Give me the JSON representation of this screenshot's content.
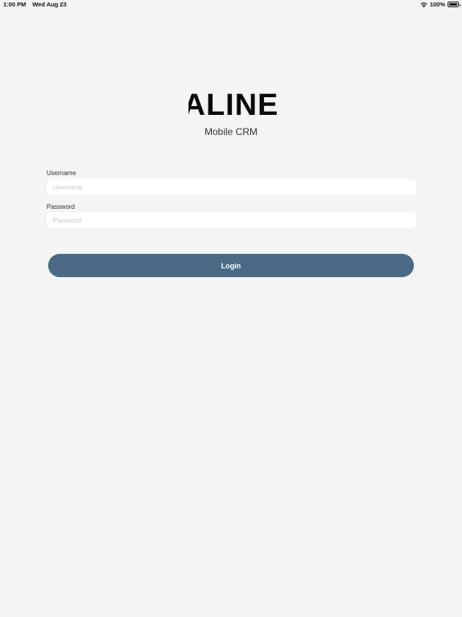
{
  "status_bar": {
    "time": "1:00 PM",
    "date": "Wed Aug 23",
    "battery": "100%",
    "wifi_icon": "wifi-icon",
    "battery_icon": "battery-icon"
  },
  "brand": {
    "logo_text": "ALINE",
    "subtitle": "Mobile CRM"
  },
  "form": {
    "username_label": "Username",
    "username_placeholder": "Username",
    "username_value": "",
    "password_label": "Password",
    "password_placeholder": "Password",
    "password_value": "",
    "login_label": "Login"
  },
  "colors": {
    "background": "#f4f4f4",
    "button": "#4a6a85",
    "input": "#ffffff"
  }
}
